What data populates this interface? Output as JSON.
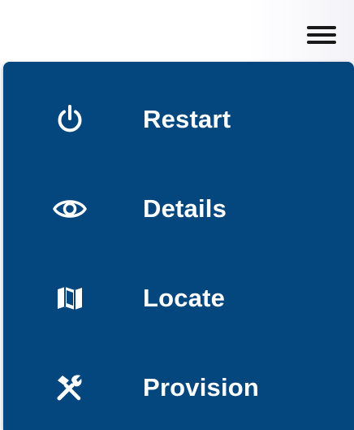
{
  "header": {
    "menu_icon": "hamburger-menu-icon"
  },
  "menu": {
    "background_color": "#04477f",
    "text_color": "#ffffff",
    "items": [
      {
        "label": "Restart",
        "icon": "power-icon"
      },
      {
        "label": "Details",
        "icon": "eye-icon"
      },
      {
        "label": "Locate",
        "icon": "map-icon"
      },
      {
        "label": "Provision",
        "icon": "tools-icon"
      }
    ]
  }
}
